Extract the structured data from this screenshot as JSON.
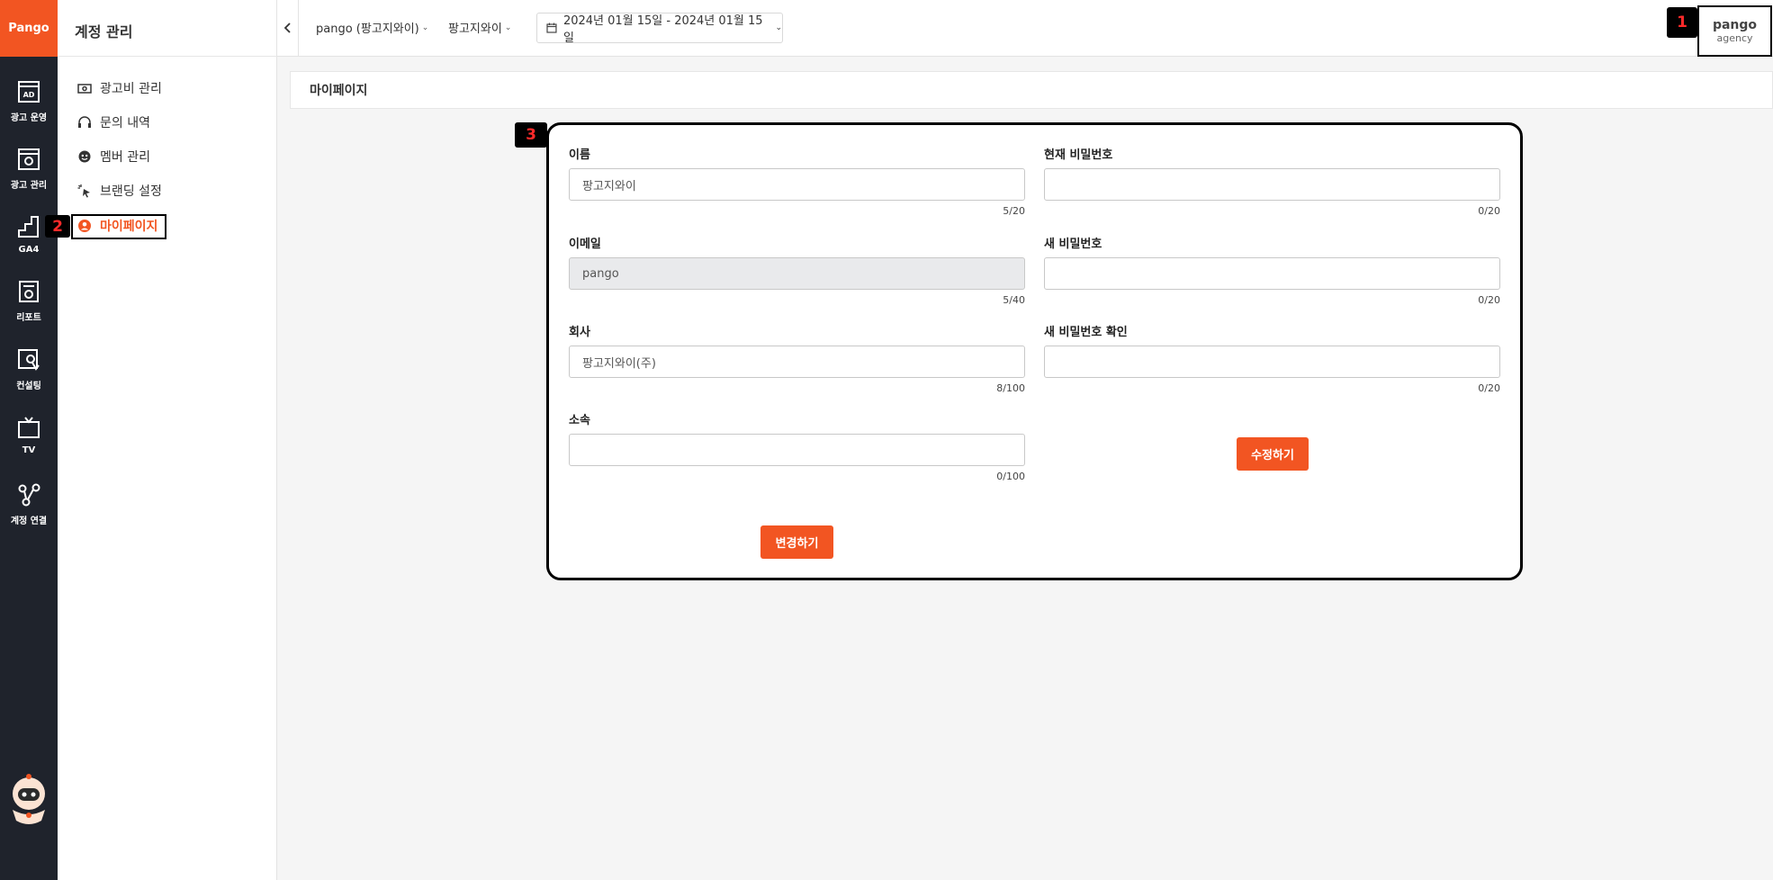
{
  "rail": {
    "logo": "Pango",
    "items": [
      {
        "label": "광고 운영",
        "icon": "ad-icon"
      },
      {
        "label": "광고 관리",
        "icon": "ad-settings-icon"
      },
      {
        "label": "GA4",
        "icon": "analytics-icon"
      },
      {
        "label": "리포트",
        "icon": "report-icon"
      },
      {
        "label": "컨설팅",
        "icon": "consulting-icon"
      },
      {
        "label": "TV",
        "icon": "tv-icon"
      },
      {
        "label": "계정 연결",
        "icon": "connect-icon"
      }
    ]
  },
  "sidebar": {
    "title": "계정 관리",
    "items": [
      {
        "label": "광고비 관리",
        "icon": "money-icon"
      },
      {
        "label": "문의 내역",
        "icon": "headset-icon"
      },
      {
        "label": "멤버 관리",
        "icon": "member-icon"
      },
      {
        "label": "브랜딩 설정",
        "icon": "branding-icon"
      },
      {
        "label": "마이페이지",
        "icon": "user-circle-icon",
        "active": true
      }
    ]
  },
  "topbar": {
    "account": "pango (팡고지와이)",
    "brand": "팡고지와이",
    "date_range": "2024년 01월 15일 - 2024년 01월 15일",
    "user_name": "pango",
    "user_role": "agency"
  },
  "page": {
    "title": "마이페이지"
  },
  "form": {
    "name": {
      "label": "이름",
      "value": "팡고지와이",
      "count": "5/20"
    },
    "email": {
      "label": "이메일",
      "value": "pango",
      "count": "5/40"
    },
    "company": {
      "label": "회사",
      "value": "팡고지와이(주)",
      "count": "8/100"
    },
    "affiliation": {
      "label": "소속",
      "value": "",
      "count": "0/100"
    },
    "current_password": {
      "label": "현재 비밀번호",
      "value": "",
      "count": "0/20"
    },
    "new_password": {
      "label": "새 비밀번호",
      "value": "",
      "count": "0/20"
    },
    "confirm_password": {
      "label": "새 비밀번호 확인",
      "value": "",
      "count": "0/20"
    },
    "change_button": "변경하기",
    "modify_button": "수정하기"
  },
  "markers": {
    "one": "1",
    "two": "2",
    "three": "3"
  },
  "colors": {
    "accent": "#f25522",
    "rail": "#1f232c"
  }
}
